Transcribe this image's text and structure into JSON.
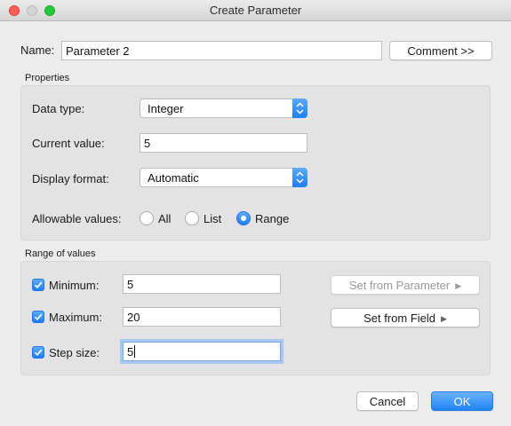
{
  "window": {
    "title": "Create Parameter"
  },
  "name": {
    "label": "Name:",
    "value": "Parameter 2"
  },
  "comment_button": "Comment >>",
  "properties": {
    "title": "Properties",
    "data_type": {
      "label": "Data type:",
      "value": "Integer"
    },
    "current_value": {
      "label": "Current value:",
      "value": "5"
    },
    "display_format": {
      "label": "Display format:",
      "value": "Automatic"
    },
    "allowable_values": {
      "label": "Allowable values:",
      "options": [
        "All",
        "List",
        "Range"
      ],
      "selected": "Range"
    }
  },
  "range": {
    "title": "Range of values",
    "minimum": {
      "label": "Minimum:",
      "value": "5",
      "checked": true
    },
    "maximum": {
      "label": "Maximum:",
      "value": "20",
      "checked": true
    },
    "step_size": {
      "label": "Step size:",
      "value": "5",
      "checked": true
    },
    "set_from_parameter": "Set from Parameter",
    "set_from_field": "Set from Field"
  },
  "footer": {
    "cancel": "Cancel",
    "ok": "OK"
  },
  "colors": {
    "accent": "#1e83f7",
    "focus_ring": "#a6c8f4"
  }
}
